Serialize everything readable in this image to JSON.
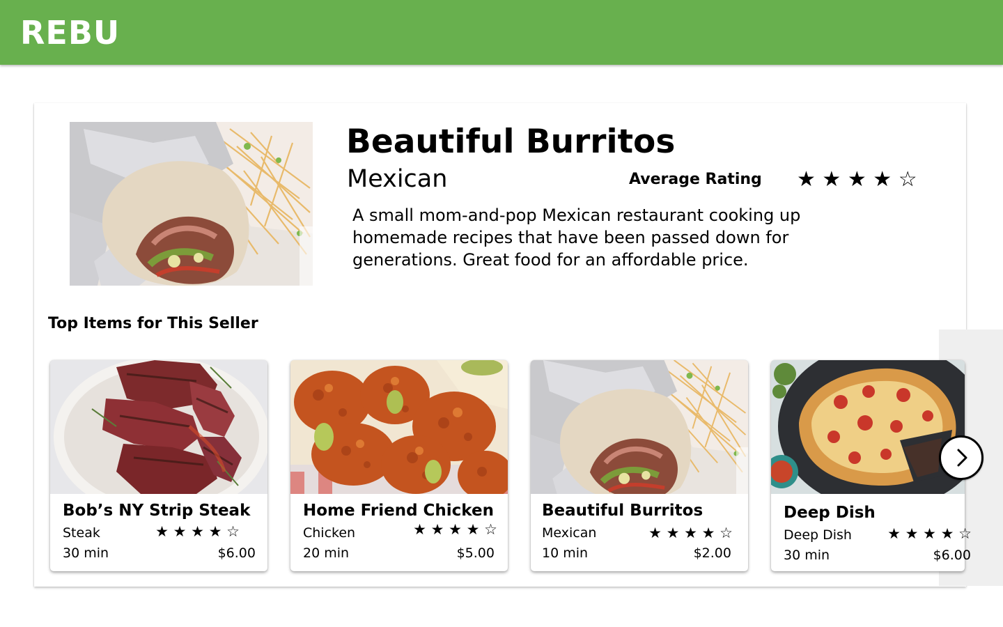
{
  "header": {
    "brand": "REBU",
    "brand_color": "#68b04e"
  },
  "store": {
    "name": "Beautiful Burritos",
    "cuisine": "Mexican",
    "rating_label": "Average Rating",
    "rating": 4,
    "rating_max": 5,
    "rating_stars": "★ ★ ★ ★ ☆",
    "description": "A small mom-and-pop Mexican restaurant cooking up homemade recipes that have been passed down for generations. Great food for an affordable price.",
    "image": "burrito-photo"
  },
  "top_items": {
    "title": "Top Items for This Seller",
    "items": [
      {
        "name": "Bob’s NY Strip Steak",
        "category": "Steak",
        "rating": 4,
        "stars": "★ ★ ★ ★ ☆",
        "time": "30 min",
        "price": "$6.00",
        "image": "steak-photo"
      },
      {
        "name": "Home Friend Chicken",
        "category": "Chicken",
        "rating": 4,
        "stars": "★ ★ ★ ★ ☆",
        "time": "20 min",
        "price": "$5.00",
        "image": "fried-chicken-photo"
      },
      {
        "name": "Beautiful Burritos",
        "category": "Mexican",
        "rating": 4,
        "stars": "★ ★ ★ ★ ☆",
        "time": "10 min",
        "price": "$2.00",
        "image": "burrito-photo"
      },
      {
        "name": "Deep Dish",
        "category": "Deep Dish",
        "rating": 4,
        "stars": "★ ★ ★ ★ ☆",
        "time": "30 min",
        "price": "$6.00",
        "image": "deep-dish-pizza-photo"
      }
    ],
    "next_icon": "chevron-right-icon"
  }
}
